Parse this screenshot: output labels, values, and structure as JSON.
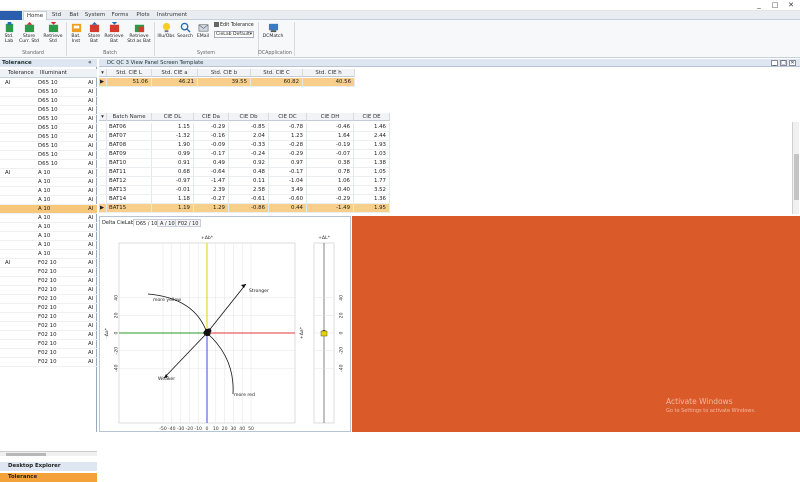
{
  "title_bar": {
    "controls": [
      "_",
      "□",
      "✕"
    ]
  },
  "menu": {
    "file_label": "",
    "tabs": [
      "Home",
      "Std",
      "Bat",
      "System",
      "Forms",
      "Plots",
      "Instrument"
    ],
    "active_tab": "Home"
  },
  "ribbon": {
    "standard": {
      "group": "Standard",
      "buttons": [
        "Std. Lab",
        "Store Curr. Std",
        "Retrieve Std"
      ]
    },
    "batch": {
      "group": "Batch",
      "buttons": [
        "Bat. Inst",
        "Store Bat",
        "Retrieve Bat",
        "Retrieve Std as Bat"
      ]
    },
    "system": {
      "group": "System",
      "buttons": [
        "Illu/Obs",
        "Search",
        "EMail"
      ],
      "edit_tolerance": "Edit Tolerance",
      "space_select": "CieLab Default"
    },
    "dcapp": {
      "group": "DCApplication",
      "buttons": [
        "DCMatch"
      ]
    }
  },
  "left_panel": {
    "title": "Tolerance",
    "pin": "«",
    "columns": [
      "Tolerance",
      "Illuminant"
    ],
    "rows": [
      {
        "tol": "AI",
        "ill": "D65 10",
        "v": "AI"
      },
      {
        "tol": "",
        "ill": "D65 10",
        "v": "AI"
      },
      {
        "tol": "",
        "ill": "D65 10",
        "v": "AI"
      },
      {
        "tol": "",
        "ill": "D65 10",
        "v": "AI"
      },
      {
        "tol": "",
        "ill": "D65 10",
        "v": "AI"
      },
      {
        "tol": "",
        "ill": "D65 10",
        "v": "AI"
      },
      {
        "tol": "",
        "ill": "D65 10",
        "v": "AI"
      },
      {
        "tol": "",
        "ill": "D65 10",
        "v": "AI"
      },
      {
        "tol": "",
        "ill": "D65 10",
        "v": "AI"
      },
      {
        "tol": "",
        "ill": "D65 10",
        "v": "AI"
      },
      {
        "tol": "AI",
        "ill": "A 10",
        "v": "AI"
      },
      {
        "tol": "",
        "ill": "A 10",
        "v": "AI"
      },
      {
        "tol": "",
        "ill": "A 10",
        "v": "AI"
      },
      {
        "tol": "",
        "ill": "A 10",
        "v": "AI"
      },
      {
        "tol": "",
        "ill": "A 10",
        "v": "AI"
      },
      {
        "tol": "",
        "ill": "A 10",
        "v": "AI"
      },
      {
        "tol": "",
        "ill": "A 10",
        "v": "AI"
      },
      {
        "tol": "",
        "ill": "A 10",
        "v": "AI"
      },
      {
        "tol": "",
        "ill": "A 10",
        "v": "AI"
      },
      {
        "tol": "",
        "ill": "A 10",
        "v": "AI"
      },
      {
        "tol": "AI",
        "ill": "F02 10",
        "v": "AI"
      },
      {
        "tol": "",
        "ill": "F02 10",
        "v": "AI"
      },
      {
        "tol": "",
        "ill": "F02 10",
        "v": "AI"
      },
      {
        "tol": "",
        "ill": "F02 10",
        "v": "AI"
      },
      {
        "tol": "",
        "ill": "F02 10",
        "v": "AI"
      },
      {
        "tol": "",
        "ill": "F02 10",
        "v": "AI"
      },
      {
        "tol": "",
        "ill": "F02 10",
        "v": "AI"
      },
      {
        "tol": "",
        "ill": "F02 10",
        "v": "AI"
      },
      {
        "tol": "",
        "ill": "F02 10",
        "v": "AI"
      },
      {
        "tol": "",
        "ill": "F02 10",
        "v": "AI"
      },
      {
        "tol": "",
        "ill": "F02 10",
        "v": "AI"
      },
      {
        "tol": "",
        "ill": "F02 10",
        "v": "AI"
      }
    ],
    "selected_row": 14,
    "desktop_explorer": "Desktop Explorer",
    "tolerance_tab": "Tolerance"
  },
  "child_window": {
    "title": "DC QC 3 View Panel Screen Template",
    "controls": [
      "_",
      "□",
      "✕"
    ]
  },
  "std_grid": {
    "columns": [
      "Std. CIE L",
      "Std. CIE a",
      "Std. CIE b",
      "Std. CIE C",
      "Std. CIE h"
    ],
    "values": [
      "51.06",
      "46.21",
      "39.55",
      "60.82",
      "40.56"
    ]
  },
  "batch_grid": {
    "columns": [
      "Batch Name",
      "CIE DL",
      "CIE Da",
      "CIE Db",
      "CIE DC",
      "CIE DH",
      "CIE DE"
    ],
    "rows": [
      [
        "BAT06",
        "1.15",
        "-0.29",
        "-0.85",
        "-0.78",
        "-0.46",
        "1.46"
      ],
      [
        "BAT07",
        "-1.32",
        "-0.16",
        "2.04",
        "1.23",
        "1.64",
        "2.44"
      ],
      [
        "BAT08",
        "1.90",
        "-0.09",
        "-0.33",
        "-0.28",
        "-0.19",
        "1.93"
      ],
      [
        "BAT09",
        "0.99",
        "-0.17",
        "-0.24",
        "-0.29",
        "-0.07",
        "1.03"
      ],
      [
        "BAT10",
        "0.91",
        "0.49",
        "0.92",
        "0.97",
        "0.38",
        "1.38"
      ],
      [
        "BAT11",
        "0.68",
        "-0.64",
        "0.48",
        "-0.17",
        "0.78",
        "1.05"
      ],
      [
        "BAT12",
        "-0.97",
        "-1.47",
        "0.11",
        "-1.04",
        "1.06",
        "1.77"
      ],
      [
        "BAT13",
        "-0.01",
        "2.39",
        "2.58",
        "3.49",
        "0.40",
        "3.52"
      ],
      [
        "BAT14",
        "1.18",
        "-0.27",
        "-0.61",
        "-0.60",
        "-0.29",
        "1.36"
      ],
      [
        "BAT15",
        "1.19",
        "1.29",
        "-0.86",
        "0.44",
        "-1.49",
        "1.95"
      ]
    ],
    "selected_row": 9
  },
  "plot": {
    "label": "Delta CieLab",
    "tabs": [
      "D65 / 10",
      "A / 10",
      "F02 / 10"
    ],
    "active_tab": "D65 / 10",
    "axis_top": "+Δb*",
    "axis_bottom": "-Δb*",
    "axis_left": "-Δa*",
    "axis_right": "+Δa*",
    "l_top": "+ΔL*",
    "l_bottom": "-ΔL*",
    "x_ticks": [
      "-50",
      "-40",
      "-30",
      "-20",
      "-10",
      "0",
      "10",
      "20",
      "30",
      "40",
      "50"
    ],
    "y_ticks": [
      "40",
      "20",
      "0",
      "-20",
      "-40"
    ],
    "l_ticks": [
      "40",
      "20",
      "0",
      "-20",
      "-40"
    ],
    "annotations": {
      "stronger": "Stronger",
      "weaker": "Weaker",
      "more_yellow": "more yellow",
      "more_red": "more red"
    },
    "colors": {
      "yellow": "#e6d200",
      "blue": "#3a4fd6",
      "green": "#2a9a2a",
      "red": "#e03a3a"
    }
  },
  "watermark": {
    "line1": "Activate Windows",
    "line2": "Go to Settings to activate Windows."
  }
}
